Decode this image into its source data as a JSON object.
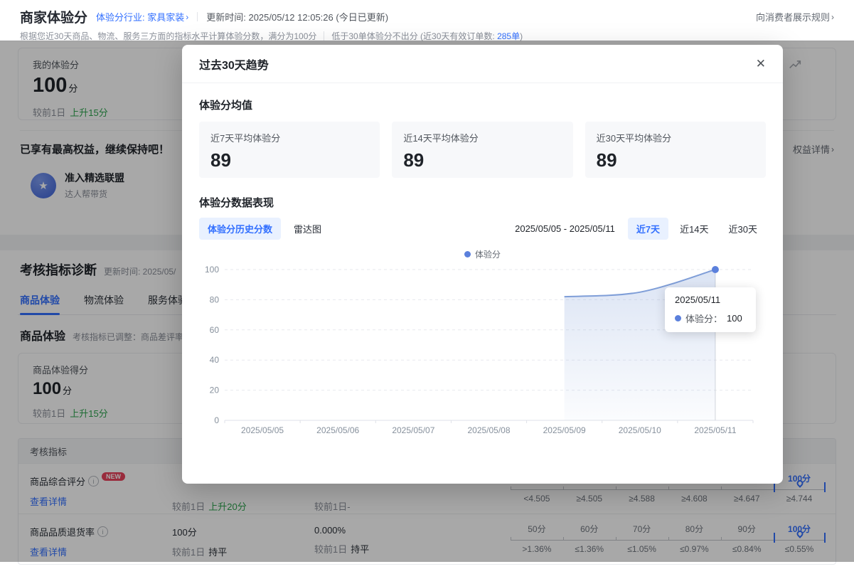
{
  "colors": {
    "accent": "#3370ff",
    "accent_bg": "#e9f1ff",
    "green": "#2ea44f",
    "badge_red": "#e8425c",
    "line": "#7f9ed8",
    "point": "#5b80dc",
    "grid": "#e7e9ee",
    "axis_line": "#dfe2e8",
    "axis_text": "#86909c"
  },
  "header": {
    "title": "商家体验分",
    "industry_label": "体验分行业: 家具家装",
    "updated": "更新时间: 2025/05/12 12:05:26 (今日已更新)",
    "show_rules": "向消费者展示规则",
    "desc_main": "根据您近30天商品、物流、服务三方面的指标水平计算体验分数，满分为100分",
    "desc_secondary": "低于30单体验分不出分 (近30天有效订单数: ",
    "order_count": "285单",
    "desc_close": ")"
  },
  "overview": {
    "score_label": "我的体验分",
    "score_value": "100",
    "score_unit": "分",
    "delta_prefix": "较前1日",
    "delta_text": "上升15分",
    "benefit_title": "已享有最高权益，继续保持吧！",
    "benefit_link": "权益详情",
    "badge_title": "准入精选联盟",
    "badge_subtitle": "达人帮带货"
  },
  "diagnosis": {
    "title": "考核指标诊断",
    "updated_partial": "更新时间: 2025/05/",
    "tabs": [
      {
        "label": "商品体验"
      },
      {
        "label": "物流体验"
      },
      {
        "label": "服务体验"
      }
    ],
    "section_title": "商品体验",
    "section_note": "考核指标已调整：商品差评率不",
    "score_label": "商品体验得分",
    "score_value": "100",
    "score_unit": "分",
    "delta_prefix": "较前1日",
    "delta_text": "上升15分",
    "table": {
      "header": "考核指标",
      "rows": [
        {
          "name": "商品综合评分",
          "badge": "NEW",
          "link": "查看详情",
          "col2_prefix": "较前1日",
          "col2_delta": "上升20分",
          "col3_text": "较前1日-",
          "scale_top": [
            "",
            "",
            "",
            "",
            "",
            "100分"
          ],
          "scale_bottom": [
            "<4.505",
            "≥4.505",
            "≥4.588",
            "≥4.608",
            "≥4.647",
            "≥4.744"
          ]
        },
        {
          "name": "商品品质退货率",
          "link": "查看详情",
          "col2_value": "100分",
          "col2_prefix": "较前1日",
          "col2_delta": "持平",
          "col3_value": "0.000%",
          "col3_prefix": "较前1日",
          "col3_delta": "持平",
          "scale_top": [
            "50分",
            "60分",
            "70分",
            "80分",
            "90分",
            "100分"
          ],
          "scale_bottom": [
            ">1.36%",
            "≤1.36%",
            "≤1.05%",
            "≤0.97%",
            "≤0.84%",
            "≤0.55%"
          ]
        }
      ]
    }
  },
  "modal": {
    "title": "过去30天趋势",
    "avg_title": "体验分均值",
    "stats": [
      {
        "label": "近7天平均体验分",
        "value": "89"
      },
      {
        "label": "近14天平均体验分",
        "value": "89"
      },
      {
        "label": "近30天平均体验分",
        "value": "89"
      }
    ],
    "perf_title": "体验分数据表现",
    "view_tabs": [
      {
        "label": "体验分历史分数"
      },
      {
        "label": "雷达图"
      }
    ],
    "date_range": "2025/05/05 - 2025/05/11",
    "range_tabs": [
      {
        "label": "近7天"
      },
      {
        "label": "近14天"
      },
      {
        "label": "近30天"
      }
    ],
    "legend_label": "体验分",
    "tooltip": {
      "date": "2025/05/11",
      "label": "体验分：",
      "value": "100"
    }
  },
  "chart_data": {
    "type": "area",
    "title": "体验分历史分数（近7天）",
    "x": [
      "2025/05/05",
      "2025/05/06",
      "2025/05/07",
      "2025/05/08",
      "2025/05/09",
      "2025/05/10",
      "2025/05/11"
    ],
    "series": [
      {
        "name": "体验分",
        "values": [
          null,
          null,
          null,
          null,
          82,
          85,
          100
        ]
      }
    ],
    "ylim": [
      0,
      100
    ],
    "yticks": [
      0,
      20,
      40,
      60,
      80,
      100
    ],
    "xlabel": "",
    "ylabel": "",
    "grid": "horizontal-dashed",
    "legend_position": "top-center",
    "highlight_x": "2025/05/11",
    "highlight_value": 100
  }
}
